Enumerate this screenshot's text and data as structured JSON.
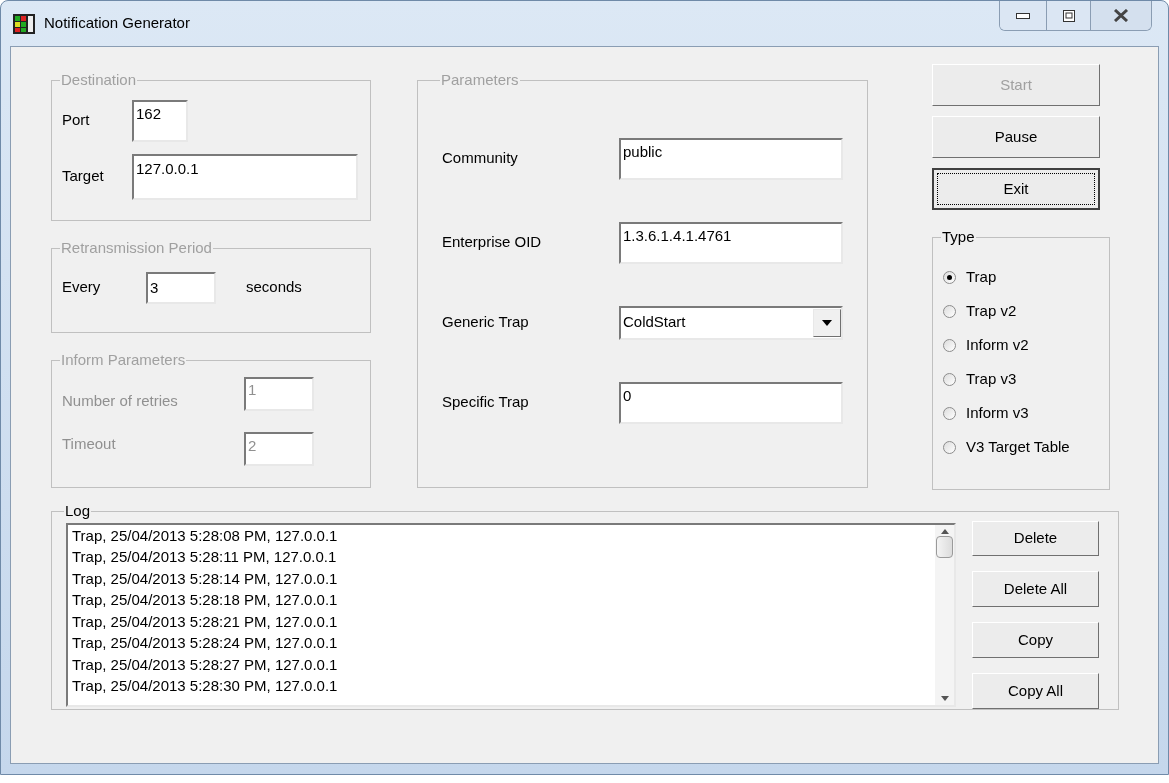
{
  "window": {
    "title": "Notification Generator"
  },
  "destination": {
    "title": "Destination",
    "disabled": true,
    "fields": [
      {
        "label": "Port",
        "value": "162",
        "disabled": false
      },
      {
        "label": "Target",
        "value": "127.0.0.1",
        "disabled": false
      }
    ]
  },
  "retransmission": {
    "title": "Retransmission Period",
    "disabled": true,
    "label": "Every",
    "value": "3",
    "unit": "seconds"
  },
  "inform": {
    "title": "Inform Parameters",
    "disabled": true,
    "fields": [
      {
        "label": "Number of retries",
        "value": "1",
        "disabled": true
      },
      {
        "label": "Timeout",
        "value": "2",
        "disabled": true
      }
    ]
  },
  "parameters": {
    "title": "Parameters",
    "disabled": true,
    "fields": [
      {
        "kind": "text",
        "label": "Community",
        "value": "public"
      },
      {
        "kind": "text",
        "label": "Enterprise OID",
        "value": "1.3.6.1.4.1.4761"
      },
      {
        "kind": "dropdown",
        "label": "Generic Trap",
        "value": "ColdStart"
      },
      {
        "kind": "text",
        "label": "Specific Trap",
        "value": "0"
      }
    ]
  },
  "buttons": [
    {
      "label": "Start",
      "disabled": true,
      "focused": false
    },
    {
      "label": "Pause",
      "disabled": false,
      "focused": false
    },
    {
      "label": "Exit",
      "disabled": false,
      "focused": true
    }
  ],
  "type": {
    "title": "Type",
    "disabled": false,
    "options": [
      {
        "label": "Trap",
        "selected": true
      },
      {
        "label": "Trap v2",
        "selected": false
      },
      {
        "label": "Inform v2",
        "selected": false
      },
      {
        "label": "Trap v3",
        "selected": false
      },
      {
        "label": "Inform v3",
        "selected": false
      },
      {
        "label": "V3 Target Table",
        "selected": false
      }
    ]
  },
  "log": {
    "title": "Log",
    "disabled": false,
    "entries": [
      "Trap, 25/04/2013 5:28:08 PM, 127.0.0.1",
      "Trap, 25/04/2013 5:28:11 PM, 127.0.0.1",
      "Trap, 25/04/2013 5:28:14 PM, 127.0.0.1",
      "Trap, 25/04/2013 5:28:18 PM, 127.0.0.1",
      "Trap, 25/04/2013 5:28:21 PM, 127.0.0.1",
      "Trap, 25/04/2013 5:28:24 PM, 127.0.0.1",
      "Trap, 25/04/2013 5:28:27 PM, 127.0.0.1",
      "Trap, 25/04/2013 5:28:30 PM, 127.0.0.1"
    ],
    "buttons": [
      "Delete",
      "Delete All",
      "Copy",
      "Copy All"
    ]
  }
}
